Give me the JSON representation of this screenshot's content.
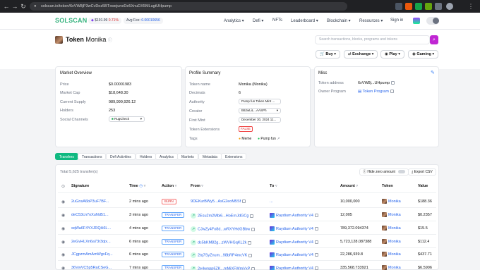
{
  "browser": {
    "url": "solscan.io/token/6xVW8jP3wCvDoz5BTxwejuneDe5XnuDX5MLugtUHpump"
  },
  "header": {
    "logo": "SOLSCAN",
    "sol_price": "$191.99",
    "sol_change": "0.71%",
    "avg_fee_label": "Avg Fee:",
    "avg_fee_value": "0.00010656",
    "nav": [
      "Analytics",
      "Defi",
      "NFTs",
      "Leaderboard",
      "Blockchain",
      "Resources",
      "Sign in"
    ]
  },
  "page": {
    "title_prefix": "Token",
    "title_name": "Monika",
    "search_placeholder": "Search transactions, blocks, programs and tokens",
    "actions": [
      "Buy",
      "Exchange",
      "Play",
      "Gaming"
    ]
  },
  "market_overview": {
    "title": "Market Overview",
    "rows": [
      {
        "label": "Price",
        "value": "$0.00001983"
      },
      {
        "label": "Market Cap",
        "value": "$18,648.30"
      },
      {
        "label": "Current Supply",
        "value": "989,999,926.12"
      },
      {
        "label": "Holders",
        "value": "253"
      },
      {
        "label": "Social Channels",
        "value": "RugCheck"
      }
    ]
  },
  "profile_summary": {
    "title": "Profile Summary",
    "rows": [
      {
        "label": "Token name",
        "value": "Monika (Monika)"
      },
      {
        "label": "Decimals",
        "value": "6"
      },
      {
        "label": "Authority",
        "value": "Pump fun Token Mint ..."
      },
      {
        "label": "Creator",
        "value": "B62wLiL...AASPh"
      },
      {
        "label": "First Mint",
        "value": "December 30, 2024 11..."
      },
      {
        "label": "Token Extensions",
        "value": "FALSE"
      },
      {
        "label": "Tags",
        "value": "Meme",
        "value2": "Pump fun"
      }
    ]
  },
  "misc": {
    "title": "Misc",
    "rows": [
      {
        "label": "Token address",
        "value": "6xVW8j...UHpump"
      },
      {
        "label": "Owner Program",
        "value": "Token Program"
      }
    ]
  },
  "tabs": [
    "Transfers",
    "Transactions",
    "Defi Activities",
    "Holders",
    "Analytics",
    "Markets",
    "Metadata",
    "Extensions"
  ],
  "table": {
    "total_label": "Total 5,625 transfer(s)",
    "hide_zero_label": "Hide zero amount",
    "export_label": "Export CSV",
    "columns": [
      "Signature",
      "Time",
      "Action",
      "From",
      "To",
      "Amount",
      "Token",
      "Value"
    ],
    "rows": [
      {
        "signature": "2uGnsA6bP3uF7BF...",
        "time": "2 mins ago",
        "action": "BURN",
        "from": "9DEKurBWy5...AsG2eoM5Sf",
        "to": "...",
        "amount": "10,000,000",
        "token": "Monika",
        "value": "$188.36"
      },
      {
        "signature": "deC53cn7oXuNd51...",
        "time": "3 mins ago",
        "action": "TRANSFER",
        "from": "2Esu2m2Mbi6...HoErnJdGCg",
        "to": "Raydium Authority V4",
        "amount": "12,005",
        "token": "Monika",
        "value": "$0.2357"
      },
      {
        "signature": "sqWa6F4YXJRQA6L...",
        "time": "4 mins ago",
        "action": "TRANSFER",
        "from": "CJwZy4Fo8d...wRXYHdGBbw",
        "to": "Raydium Authority V4",
        "amount": "789,372.094374",
        "token": "Monika",
        "value": "$15.5"
      },
      {
        "signature": "2eGvHLXn6a73r3qix...",
        "time": "6 mins ago",
        "action": "TRANSFER",
        "from": "dc5bKM82g...zWVHGqKL2k",
        "to": "Raydium Authority V4",
        "amount": "5,723,128.087388",
        "token": "Monika",
        "value": "$112.4"
      },
      {
        "signature": "JCgpzmAmAmWgvFq...",
        "time": "6 mins ago",
        "action": "TRANSFER",
        "from": "2tq7SyZnum...98bRP4mcVK",
        "to": "Raydium Authority V4",
        "amount": "22,286,939.8",
        "token": "Monika",
        "value": "$437.71"
      },
      {
        "signature": "36VwVC5p5RaCSeG...",
        "time": "7 mins ago",
        "action": "TRANSFER",
        "from": "2e4wnpp6ZK...mMiXFWmVxP",
        "to": "Raydium Authority V4",
        "amount": "335,568.733921",
        "token": "Monika",
        "value": "$6.5906"
      }
    ]
  }
}
